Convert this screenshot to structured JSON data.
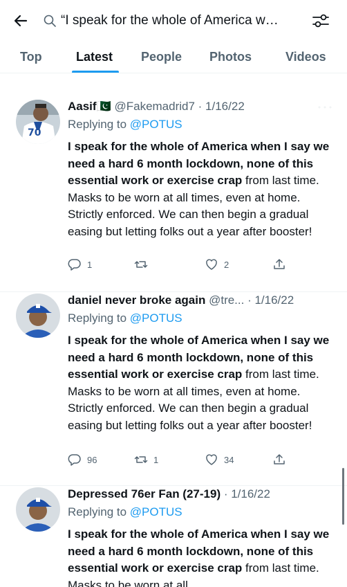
{
  "search": {
    "query": "“I speak for the whole of America w…"
  },
  "tabs": [
    {
      "label": "Top"
    },
    {
      "label": "Latest"
    },
    {
      "label": "People"
    },
    {
      "label": "Photos"
    },
    {
      "label": "Videos"
    }
  ],
  "active_tab": "Latest",
  "colors": {
    "accent": "#1d9bf0",
    "text": "#0f1419",
    "muted": "#536471"
  },
  "tweets": [
    {
      "name": "Aasif🇵🇰",
      "meta": " @Fakemadrid7 · 1/16/22",
      "replying_prefix": "Replying to ",
      "replying_handle": "@POTUS",
      "bold_text": "I speak for the whole of America when I say we need a hard 6 month lockdown, none of this essential work or exercise crap",
      "rest_text": " from last time. Masks to be worn at all times, even at home. Strictly enforced. We can then begin a gradual easing but letting folks out a year after booster!",
      "replies": "1",
      "retweets": "",
      "likes": "2"
    },
    {
      "name": "daniel never broke again",
      "meta": " @tre... · 1/16/22",
      "replying_prefix": "Replying to ",
      "replying_handle": "@POTUS",
      "bold_text": "I speak for the whole of America when I say we need a hard 6 month lockdown, none of this essential work or exercise crap",
      "rest_text": " from last time. Masks to be worn at all times, even at home. Strictly enforced. We can then begin a gradual easing but letting folks out a year after booster!",
      "replies": "96",
      "retweets": "1",
      "likes": "34"
    },
    {
      "name": "Depressed 76er Fan (27-19)",
      "meta": " · 1/16/22",
      "replying_prefix": "Replying to ",
      "replying_handle": "@POTUS",
      "bold_text": "I speak for the whole of America when I say we need a hard 6 month lockdown, none of this essential work or exercise crap",
      "rest_text": " from last time. Masks to be worn at all"
    }
  ]
}
